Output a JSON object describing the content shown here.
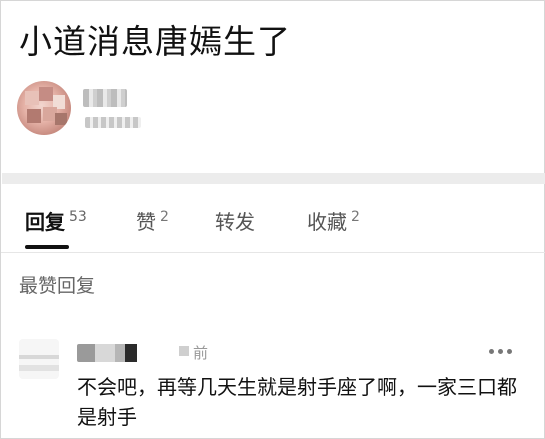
{
  "post": {
    "title": "小道消息唐嫣生了"
  },
  "tabs": [
    {
      "label": "回复",
      "count": "53"
    },
    {
      "label": "赞",
      "count": "2"
    },
    {
      "label": "转发",
      "count": ""
    },
    {
      "label": "收藏",
      "count": "2"
    }
  ],
  "section": {
    "heading": "最赞回复"
  },
  "comment": {
    "time_suffix": "前",
    "text": "不会吧，再等几天生就是射手座了啊，一家三口都是射手"
  },
  "icons": {
    "more": "more-horizontal-icon"
  },
  "colors": {
    "text": "#111111",
    "muted": "#999999",
    "divider": "#ececec"
  }
}
